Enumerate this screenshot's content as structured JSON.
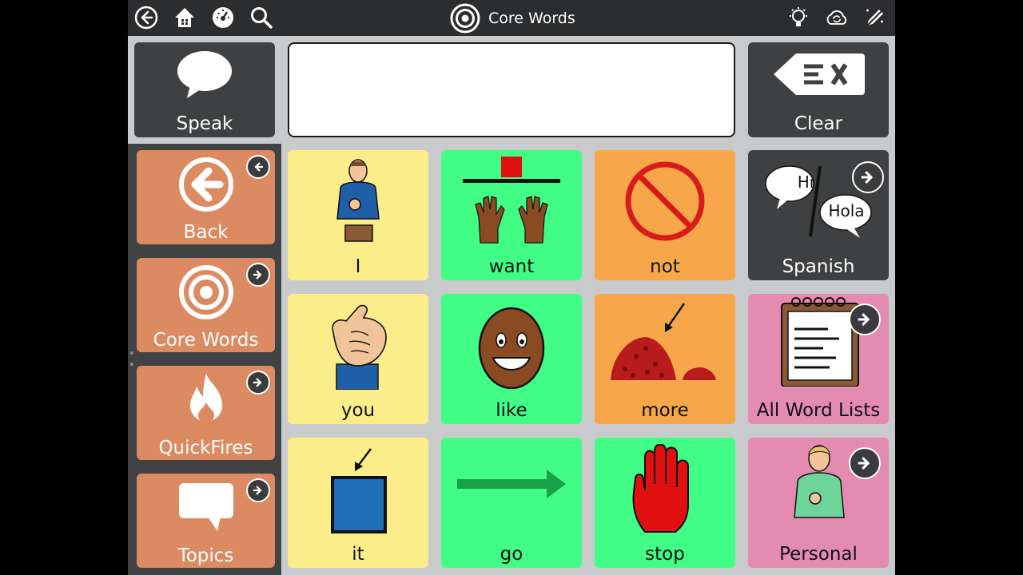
{
  "window": {
    "title": "Core Words"
  },
  "toolbar": {
    "left_icons": [
      "back-icon",
      "home-icon",
      "dashboard-icon",
      "search-icon"
    ],
    "right_icons": [
      "lightbulb-icon",
      "cloud-sync-icon",
      "edit-icon"
    ]
  },
  "top_row": {
    "speak_label": "Speak",
    "message_text": "",
    "clear_label": "Clear"
  },
  "sidebar": {
    "items": [
      {
        "label": "Back",
        "icon": "back-arrow-icon"
      },
      {
        "label": "Core Words",
        "icon": "target-icon"
      },
      {
        "label": "QuickFires",
        "icon": "fire-icon"
      },
      {
        "label": "Topics",
        "icon": "speech-bubble-icon"
      }
    ]
  },
  "grid": {
    "cells": [
      {
        "label": "I",
        "color": "#fbee8a"
      },
      {
        "label": "want",
        "color": "#41fd86"
      },
      {
        "label": "not",
        "color": "#f7a74a"
      },
      {
        "label": "Spanish",
        "color": "#3e4042",
        "bubble_left": "Hi",
        "bubble_right": "Hola"
      },
      {
        "label": "you",
        "color": "#fbee8a"
      },
      {
        "label": "like",
        "color": "#41fd86"
      },
      {
        "label": "more",
        "color": "#f7a74a"
      },
      {
        "label": "All Word Lists",
        "color": "#e38bb0"
      },
      {
        "label": "it",
        "color": "#fbee8a"
      },
      {
        "label": "go",
        "color": "#41fd86"
      },
      {
        "label": "stop",
        "color": "#41fd86"
      },
      {
        "label": "Personal",
        "color": "#e38bb0"
      }
    ]
  },
  "colors": {
    "topbar": "#2c2d2f",
    "nav_tile": "#dc8a62",
    "pronoun": "#fbee8a",
    "verb": "#41fd86",
    "adverb": "#f7a74a",
    "folder": "#e38bb0",
    "dark_tile": "#3e4042"
  }
}
